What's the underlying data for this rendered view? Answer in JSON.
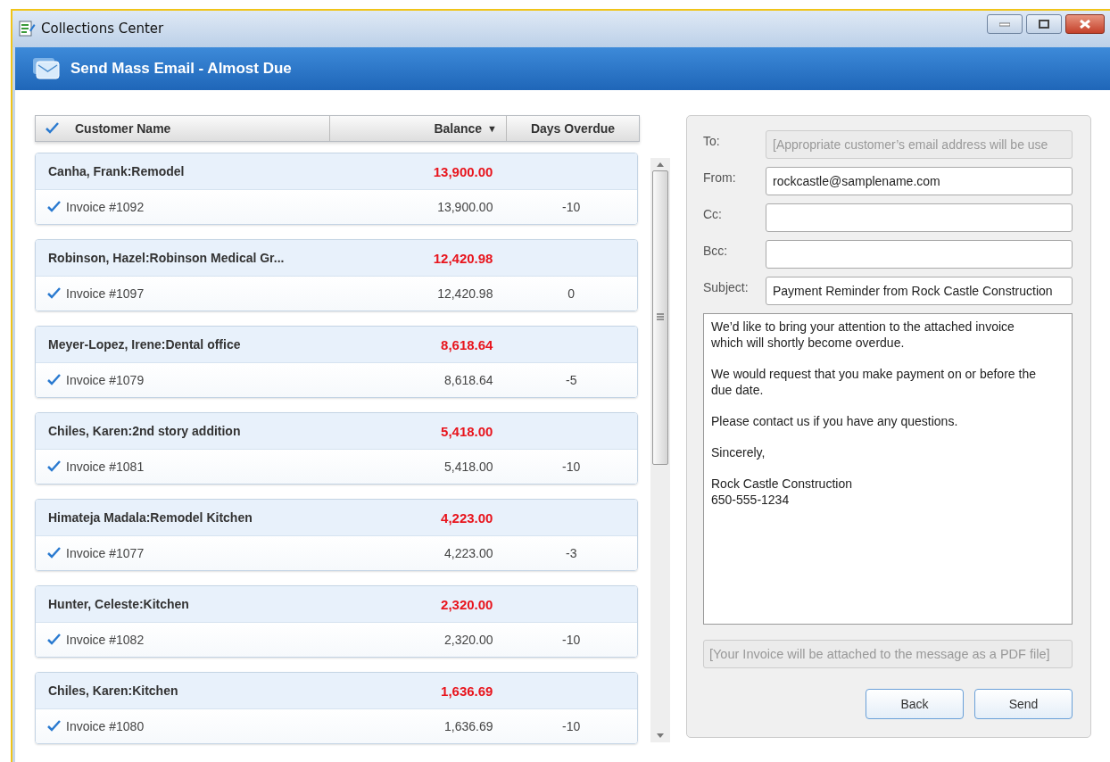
{
  "window": {
    "title": "Collections Center"
  },
  "header": {
    "title": "Send Mass Email - Almost Due"
  },
  "grid": {
    "select_all": {
      "checked": true
    },
    "columns": [
      {
        "label": "Customer Name"
      },
      {
        "label": "Balance",
        "sort": "▼"
      },
      {
        "label": "Days Overdue"
      }
    ],
    "groups": [
      {
        "customer": "Canha, Frank:Remodel",
        "balance": "13,900.00",
        "invoices": [
          {
            "label": "Invoice #1092",
            "checked": true,
            "balance": "13,900.00",
            "days_overdue": "-10"
          }
        ]
      },
      {
        "customer": "Robinson, Hazel:Robinson Medical Gr...",
        "balance": "12,420.98",
        "invoices": [
          {
            "label": "Invoice #1097",
            "checked": true,
            "balance": "12,420.98",
            "days_overdue": "0"
          }
        ]
      },
      {
        "customer": "Meyer-Lopez, Irene:Dental office",
        "balance": "8,618.64",
        "invoices": [
          {
            "label": "Invoice #1079",
            "checked": true,
            "balance": "8,618.64",
            "days_overdue": "-5"
          }
        ]
      },
      {
        "customer": "Chiles, Karen:2nd story addition",
        "balance": "5,418.00",
        "invoices": [
          {
            "label": "Invoice #1081",
            "checked": true,
            "balance": "5,418.00",
            "days_overdue": "-10"
          }
        ]
      },
      {
        "customer": "Himateja Madala:Remodel Kitchen",
        "balance": "4,223.00",
        "invoices": [
          {
            "label": "Invoice #1077",
            "checked": true,
            "balance": "4,223.00",
            "days_overdue": "-3"
          }
        ]
      },
      {
        "customer": "Hunter, Celeste:Kitchen",
        "balance": "2,320.00",
        "invoices": [
          {
            "label": "Invoice #1082",
            "checked": true,
            "balance": "2,320.00",
            "days_overdue": "-10"
          }
        ]
      },
      {
        "customer": "Chiles, Karen:Kitchen",
        "balance": "1,636.69",
        "invoices": [
          {
            "label": "Invoice #1080",
            "checked": true,
            "balance": "1,636.69",
            "days_overdue": "-10"
          }
        ]
      }
    ]
  },
  "email": {
    "fields": [
      {
        "label": "To:",
        "value": "[Appropriate customer’s email address will be use",
        "disabled": true
      },
      {
        "label": "From:",
        "value": "rockcastle@samplename.com",
        "disabled": false
      },
      {
        "label": "Cc:",
        "disabled": false
      },
      {
        "label": "Bcc:",
        "disabled": false
      },
      {
        "label": "Subject:",
        "value": "Payment Reminder from Rock Castle Construction",
        "disabled": false
      }
    ],
    "message": [
      {
        "lines": [
          "We’d like to bring your attention to the attached invoice which will shortly become overdue."
        ]
      },
      {
        "lines": [
          "We would request that you make payment on or before the due date."
        ]
      },
      {
        "lines": [
          "Please contact us if you have any questions."
        ]
      },
      {
        "lines": [
          "Sincerely,"
        ]
      },
      {
        "lines": [
          "Rock Castle Construction",
          "650-555-1234"
        ]
      }
    ],
    "attachment_note": "[Your Invoice will be attached to the message as a PDF file]",
    "buttons": [
      "Back",
      "Send"
    ]
  }
}
